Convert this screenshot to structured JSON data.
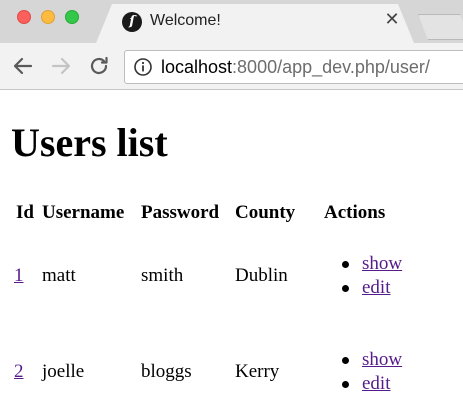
{
  "browser": {
    "tab_title": "Welcome!",
    "favicon_glyph": "sf",
    "url_host": "localhost",
    "url_path": ":8000/app_dev.php/user/",
    "close_glyph": "✕"
  },
  "page": {
    "title": "Users list",
    "columns": [
      "Id",
      "Username",
      "Password",
      "County",
      "Actions"
    ],
    "rows": [
      {
        "id": "1",
        "username": "matt",
        "password": "smith",
        "county": "Dublin",
        "actions": [
          "show",
          "edit"
        ]
      },
      {
        "id": "2",
        "username": "joelle",
        "password": "bloggs",
        "county": "Kerry",
        "actions": [
          "show",
          "edit"
        ]
      }
    ]
  },
  "colors": {
    "link": "#551a8b",
    "chrome": "#d6d6d6",
    "toolbar": "#f2f2f2"
  }
}
